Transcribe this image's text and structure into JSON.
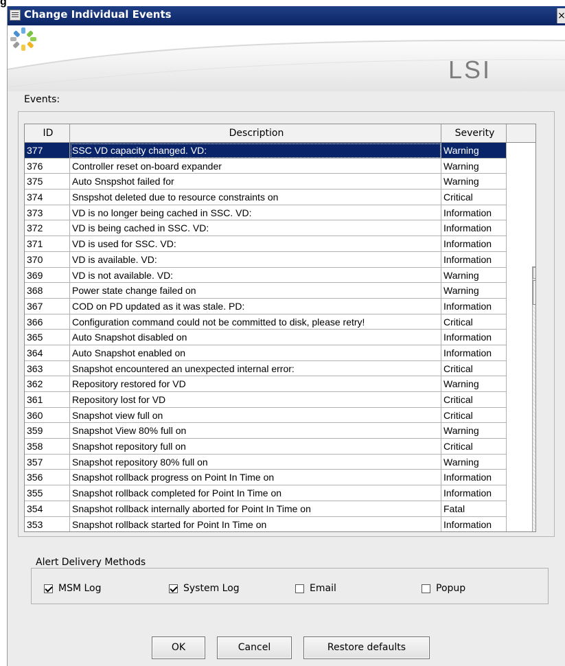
{
  "figure_label": "g",
  "window": {
    "title": "Change Individual Events",
    "close": "×"
  },
  "banner": {
    "logo_text": "LSI",
    "logo_mark": "lsi-starburst-logo",
    "colors": {
      "titlebar": "#0c2566",
      "selection": "#0a246a",
      "logo": "#7d7d7d"
    }
  },
  "events_label": "Events:",
  "table": {
    "columns": [
      "ID",
      "Description",
      "Severity"
    ],
    "selected_index": 0,
    "rows": [
      {
        "id": "377",
        "description": "SSC VD capacity changed. VD:",
        "severity": "Warning"
      },
      {
        "id": "376",
        "description": "Controller reset on-board expander",
        "severity": "Warning"
      },
      {
        "id": "375",
        "description": "Auto Snspshot failed for",
        "severity": "Warning"
      },
      {
        "id": "374",
        "description": "Snspshot deleted due to resource constraints on",
        "severity": "Critical"
      },
      {
        "id": "373",
        "description": "VD is no longer being cached in SSC. VD:",
        "severity": "Information"
      },
      {
        "id": "372",
        "description": "VD is being cached in SSC. VD:",
        "severity": "Information"
      },
      {
        "id": "371",
        "description": "VD is used for SSC. VD:",
        "severity": "Information"
      },
      {
        "id": "370",
        "description": "VD is available. VD:",
        "severity": "Information"
      },
      {
        "id": "369",
        "description": "VD is not available. VD:",
        "severity": "Warning"
      },
      {
        "id": "368",
        "description": "Power state change failed on",
        "severity": "Warning"
      },
      {
        "id": "367",
        "description": "COD on PD updated as it was stale. PD:",
        "severity": "Information"
      },
      {
        "id": "366",
        "description": "Configuration command could not be committed to disk, please retry!",
        "severity": "Critical"
      },
      {
        "id": "365",
        "description": "Auto Snapshot disabled on",
        "severity": "Information"
      },
      {
        "id": "364",
        "description": "Auto Snapshot enabled on",
        "severity": "Information"
      },
      {
        "id": "363",
        "description": "Snapshot encountered an unexpected internal error:",
        "severity": "Critical"
      },
      {
        "id": "362",
        "description": "Repository restored for VD",
        "severity": "Warning"
      },
      {
        "id": "361",
        "description": "Repository lost for VD",
        "severity": "Critical"
      },
      {
        "id": "360",
        "description": "Snapshot view full on",
        "severity": "Critical"
      },
      {
        "id": "359",
        "description": "Snapshot View 80% full on",
        "severity": "Warning"
      },
      {
        "id": "358",
        "description": "Snapshot repository full on",
        "severity": "Critical"
      },
      {
        "id": "357",
        "description": "Snapshot repository 80% full on",
        "severity": "Warning"
      },
      {
        "id": "356",
        "description": "Snapshot rollback progress on Point In Time on",
        "severity": "Information"
      },
      {
        "id": "355",
        "description": "Snapshot rollback completed for Point In Time on",
        "severity": "Information"
      },
      {
        "id": "354",
        "description": "Snapshot rollback internally aborted for Point In Time on",
        "severity": "Fatal"
      },
      {
        "id": "353",
        "description": "Snapshot rollback started for Point In Time on",
        "severity": "Information"
      }
    ]
  },
  "alert_delivery": {
    "title": "Alert Delivery Methods",
    "options": [
      {
        "label": "MSM Log",
        "checked": true
      },
      {
        "label": "System Log",
        "checked": true
      },
      {
        "label": "Email",
        "checked": false
      },
      {
        "label": "Popup",
        "checked": false
      }
    ]
  },
  "buttons": {
    "ok": "OK",
    "cancel": "Cancel",
    "restore": "Restore defaults"
  }
}
